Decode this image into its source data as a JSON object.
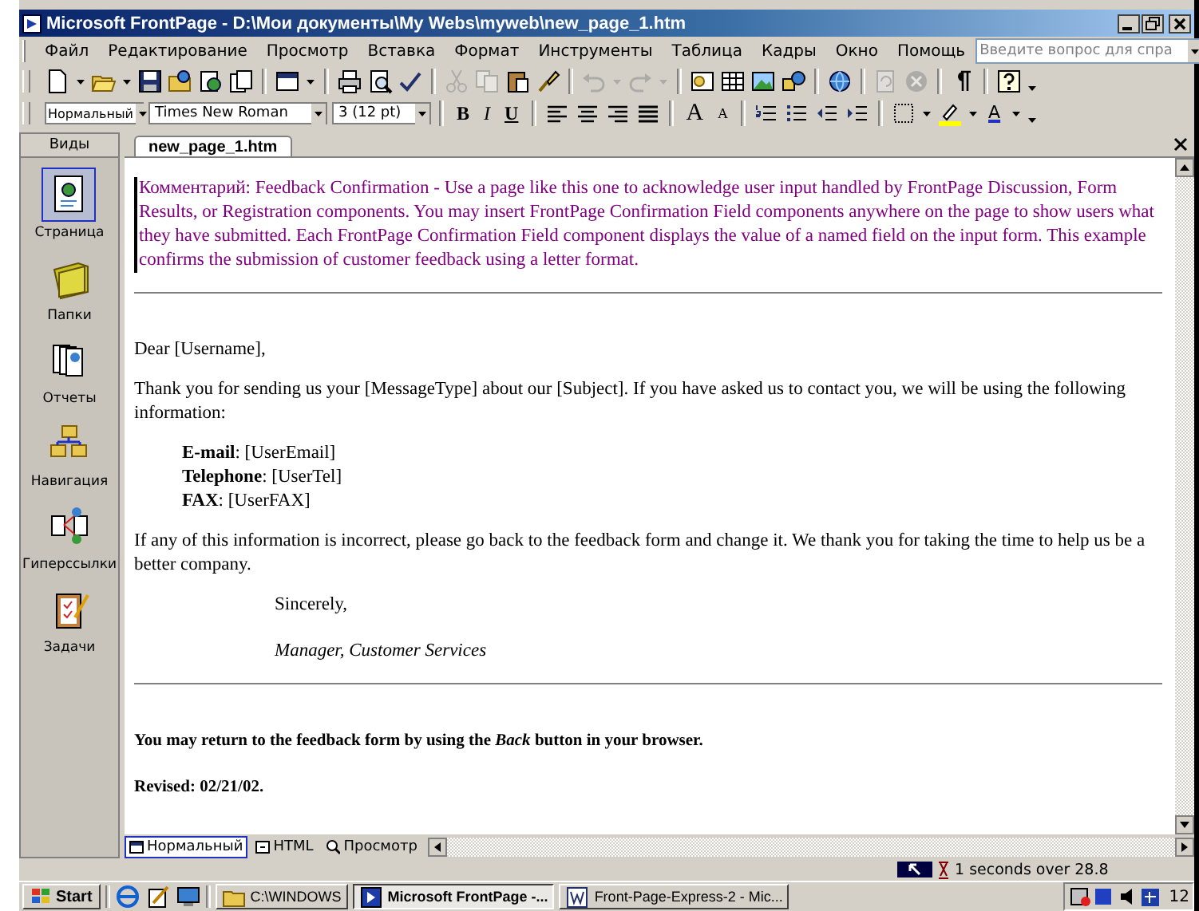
{
  "window": {
    "title": "Microsoft FrontPage - D:\\Мои документы\\My Webs\\myweb\\new_page_1.htm"
  },
  "menu": [
    "Файл",
    "Редактирование",
    "Просмотр",
    "Вставка",
    "Формат",
    "Инструменты",
    "Таблица",
    "Кадры",
    "Окно",
    "Помощь"
  ],
  "help_box": {
    "placeholder": "Введите вопрос для спра"
  },
  "toolbar": [
    {
      "disabled": false
    },
    {
      "disabled": false
    },
    {
      "disabled": false
    },
    {
      "disabled": false
    },
    {
      "disabled": false
    },
    {
      "disabled": false
    },
    {
      "disabled": false
    },
    {
      "disabled": false
    },
    {
      "disabled": false
    },
    {
      "disabled": false
    },
    {
      "disabled": false
    },
    {
      "disabled": false
    },
    {
      "disabled": false
    },
    {
      "disabled": true
    },
    {
      "disabled": true
    },
    {
      "disabled": false
    },
    {
      "disabled": false
    },
    {
      "disabled": true
    },
    {
      "disabled": true
    },
    {
      "disabled": true
    },
    {
      "disabled": true
    },
    {
      "disabled": false
    },
    {
      "disabled": false
    },
    {
      "disabled": false
    },
    {
      "disabled": false
    },
    {
      "disabled": false
    },
    {
      "disabled": true
    },
    {
      "disabled": true
    },
    {
      "disabled": false
    },
    {
      "disabled": false
    },
    {
      "disabled": false
    }
  ],
  "format_toolbar": {
    "style": "Нормальный",
    "font": "Times New Roman",
    "font_size": "3 (12 pt)",
    "bold": "B",
    "italic": "I",
    "underline": "U",
    "grow_font": "A",
    "shrink_font": "A",
    "font_color": "A"
  },
  "views": {
    "title": "Виды",
    "items": [
      {
        "kind": "page",
        "label": "Страница",
        "selected": true
      },
      {
        "kind": "folders",
        "label": "Папки",
        "selected": false
      },
      {
        "kind": "reports",
        "label": "Отчеты",
        "selected": false
      },
      {
        "kind": "navigation",
        "label": "Навигация",
        "selected": false
      },
      {
        "kind": "hyperlinks",
        "label": "Гиперссылки",
        "selected": false
      },
      {
        "kind": "tasks",
        "label": "Задачи",
        "selected": false
      }
    ]
  },
  "document": {
    "tab": "new_page_1.htm",
    "blocks": [
      {
        "kind": "comment",
        "text": "Комментарий: Feedback Confirmation - Use a page like this one to acknowledge user input handled by FrontPage Discussion, Form Results, or Registration components. You may insert FrontPage Confirmation Field components anywhere on the page to show users what they have submitted. Each FrontPage Confirmation Field component displays the value of a named field on the input form. This example confirms the submission of customer feedback using a letter format."
      },
      {
        "kind": "rule"
      },
      {
        "kind": "paragraph",
        "text": "Dear [Username],"
      },
      {
        "kind": "paragraph",
        "text": "Thank you for sending us your [MessageType] about our [Subject]. If you have asked us to contact you, we will be using the following information:"
      },
      {
        "kind": "fields",
        "items": [
          "**E-mail**: [UserEmail]",
          "**Telephone**: [UserTel]",
          "**FAX**: [UserFAX]"
        ]
      },
      {
        "kind": "paragraph",
        "text": "If any of this information is incorrect, please go back to the feedback form and change it. We thank you for taking the time to help us be a better company."
      },
      {
        "kind": "closing",
        "text": "Sincerely,"
      },
      {
        "kind": "signer",
        "text": "Manager, Customer Services"
      },
      {
        "kind": "rule"
      },
      {
        "kind": "note",
        "text": "You may return to the feedback form by using the *Back* button in your browser."
      },
      {
        "kind": "note",
        "text": "Revised: 02/21/02."
      }
    ]
  },
  "view_tabs": [
    {
      "kind": "normal",
      "label": "Нормальный",
      "selected": true
    },
    {
      "kind": "html",
      "label": "HTML",
      "selected": false
    },
    {
      "kind": "preview",
      "label": "Просмотр",
      "selected": false
    }
  ],
  "status_bar": {
    "download_time": "1 seconds over 28.8"
  },
  "taskbar": {
    "start": "Start",
    "tasks": [
      {
        "kind": "folder",
        "label": "C:\\WINDOWS",
        "selected": false
      },
      {
        "kind": "frontpage",
        "label": "Microsoft FrontPage -...",
        "selected": true
      },
      {
        "kind": "word",
        "label": "Front-Page-Express-2 - Mic...",
        "selected": false
      }
    ],
    "clock": "12"
  }
}
